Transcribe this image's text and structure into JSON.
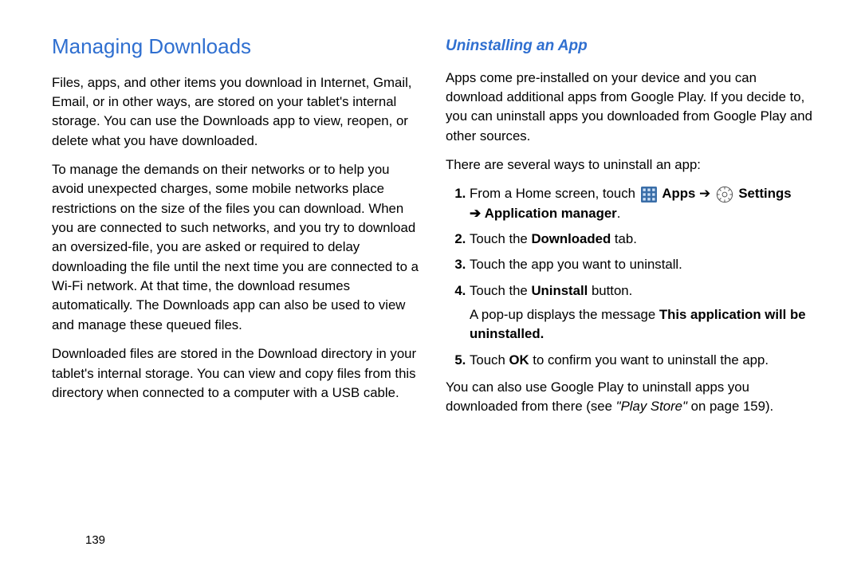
{
  "left": {
    "heading": "Managing Downloads",
    "p1": "Files, apps, and other items you download in Internet, Gmail, Email, or in other ways, are stored on your tablet's internal storage. You can use the Downloads app to view, reopen, or delete what you have downloaded.",
    "p2": "To manage the demands on their networks or to help you avoid unexpected charges, some mobile networks place restrictions on the size of the files you can download. When you are connected to such networks, and you try to download an oversized-file, you are asked or required to delay downloading the file until the next time you are connected to a Wi-Fi network. At that time, the download resumes automatically. The Downloads app can also be used to view and manage these queued files.",
    "p3": "Downloaded files are stored in the Download directory in your tablet's internal storage. You can view and copy files from this directory when connected to a computer with a USB cable."
  },
  "right": {
    "heading": "Uninstalling an App",
    "p1": "Apps come pre-installed on your device and you can download additional apps from Google Play. If you decide to, you can uninstall apps you downloaded from Google Play and other sources.",
    "p2": "There are several ways to uninstall an app:",
    "steps": {
      "s1_prefix": "From a Home screen, touch",
      "s1_apps": "Apps",
      "s1_arrow": "➔",
      "s1_settings": "Settings",
      "s1_arrow2": "➔",
      "s1_appmgr": "Application manager",
      "s1_period": ".",
      "s2_a": "Touch the ",
      "s2_b": "Downloaded",
      "s2_c": " tab.",
      "s3": "Touch the app you want to uninstall.",
      "s4_a": "Touch the ",
      "s4_b": "Uninstall",
      "s4_c": " button.",
      "s4_popup_a": "A pop-up displays the message ",
      "s4_popup_b": "This application will be uninstalled.",
      "s5_a": "Touch ",
      "s5_b": "OK",
      "s5_c": " to confirm you want to uninstall the app."
    },
    "p3_a": "You can also use Google Play to uninstall apps you downloaded from there (see ",
    "p3_b": "\"Play Store\"",
    "p3_c": " on page 159)."
  },
  "page_number": "139",
  "icons": {
    "apps": "apps-icon",
    "settings": "gear-icon"
  }
}
